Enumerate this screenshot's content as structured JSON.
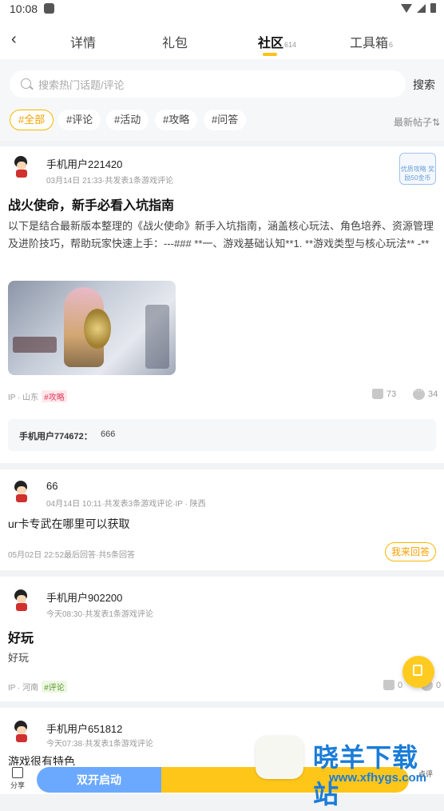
{
  "status": {
    "time": "10:08"
  },
  "tabs": [
    {
      "label": "详情",
      "count": ""
    },
    {
      "label": "礼包",
      "count": ""
    },
    {
      "label": "社区",
      "count": "614"
    },
    {
      "label": "工具箱",
      "count": "6"
    }
  ],
  "search": {
    "placeholder": "搜索热门话题/评论",
    "button": "搜索"
  },
  "filters": [
    "#全部",
    "#评论",
    "#活动",
    "#攻略",
    "#问答"
  ],
  "sort_label": "最新帖子⇅",
  "posts": [
    {
      "user": "手机用户221420",
      "meta": "03月14日 21:33·共发表1条游戏评论",
      "badge": "优质攻略 奖励50金币",
      "title": "战火使命，新手必看入坑指南",
      "body": "以下是结合最新版本整理的《战火使命》新手入坑指南，涵盖核心玩法、角色培养、资源管理及进阶技巧，帮助玩家快速上手：---### **一、游戏基础认知**1. **游戏类型与核心玩法**   -**",
      "ip": "IP · 山东",
      "tag": "#攻略",
      "likes": "73",
      "comments": "34",
      "reply_user": "手机用户774672：",
      "reply_text": "666"
    },
    {
      "user": "66",
      "meta": "04月14日 10:11·共发表3条游戏评论·IP · 陕西",
      "body": "ur卡专武在哪里可以获取",
      "last_reply": "05月02日 22:52最后回答·共5条回答",
      "answer_btn": "我来回答"
    },
    {
      "user": "手机用户902200",
      "meta": "今天08:30·共发表1条游戏评论",
      "title": "好玩",
      "body": "好玩",
      "ip": "IP · 河南",
      "tag": "#评论",
      "likes": "0",
      "comments": "0"
    },
    {
      "user": "手机用户651812",
      "meta": "今天07:38·共发表1条游戏评论",
      "body": "游戏很有特色"
    }
  ],
  "bottom": {
    "share": "分享",
    "dual": "双开启动",
    "favor": "点评"
  },
  "watermark": {
    "title": "晓羊下载站",
    "url": "www.xfhygs.com"
  }
}
